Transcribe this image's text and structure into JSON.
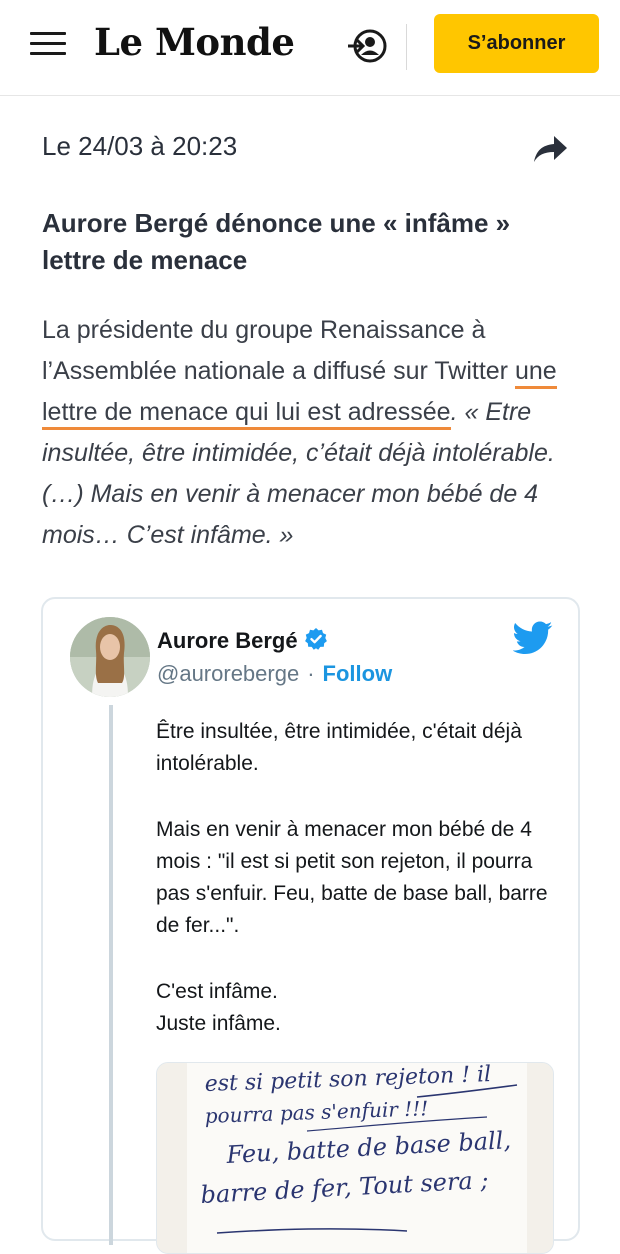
{
  "header": {
    "logo": "Le Monde",
    "subscribe_label": "S’abonner"
  },
  "post": {
    "date": "Le 24/03 à 20:23",
    "title": "Aurore Bergé dénonce une « infâme » lettre de menace",
    "intro": "La présidente du groupe Renaissance à l’Assemblée nationale a diffusé sur Twitter ",
    "link_text": "une lettre de menace qui lui est adressée",
    "quote": ". « Etre insultée, être intimidée, c’était déjà intolérable. (…) Mais en venir à menacer mon bébé de 4 mois… C’est infâme. »"
  },
  "tweet": {
    "author": "Aurore Bergé",
    "handle": "@auroreberge",
    "separator": "·",
    "follow_label": "Follow",
    "paragraphs": [
      "Être insultée, être intimidée, c'était déjà intolérable.",
      "Mais en venir à menacer mon bébé de 4 mois : \"il est si petit son rejeton, il pourra pas s'enfuir. Feu, batte de base ball, barre de fer...\".",
      "C'est infâme.\nJuste infâme."
    ],
    "image_text": [
      "est si petit son rejeton ! il",
      "pourra pas s'enfuir !!!",
      "Feu, batte de base ball,",
      "barre de fer, Tout sera ;"
    ]
  },
  "colors": {
    "subscribe_bg": "#ffc600",
    "link_underline": "#ef8a3a",
    "twitter_blue": "#1d9bf0"
  }
}
